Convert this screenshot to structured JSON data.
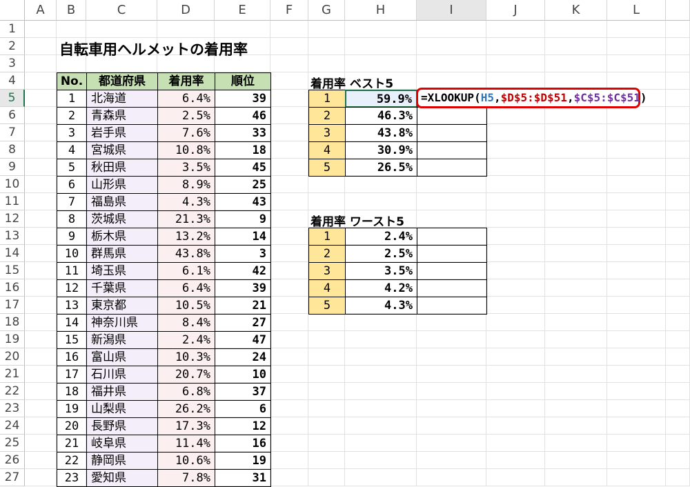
{
  "columns": [
    "A",
    "B",
    "C",
    "D",
    "E",
    "F",
    "G",
    "H",
    "I",
    "J",
    "K",
    "L",
    ""
  ],
  "rows": [
    "1",
    "2",
    "3",
    "4",
    "5",
    "6",
    "7",
    "8",
    "9",
    "10",
    "11",
    "12",
    "13",
    "14",
    "15",
    "16",
    "17",
    "18",
    "19",
    "20",
    "21",
    "22",
    "23",
    "24",
    "25",
    "26",
    "27"
  ],
  "title": "自転車用ヘルメットの着用率",
  "table": {
    "headers": [
      "No.",
      "都道府県",
      "着用率",
      "順位"
    ],
    "rows": [
      [
        "1",
        "北海道",
        "6.4%",
        "39"
      ],
      [
        "2",
        "青森県",
        "2.5%",
        "46"
      ],
      [
        "3",
        "岩手県",
        "7.6%",
        "33"
      ],
      [
        "4",
        "宮城県",
        "10.8%",
        "18"
      ],
      [
        "5",
        "秋田県",
        "3.5%",
        "45"
      ],
      [
        "6",
        "山形県",
        "8.9%",
        "25"
      ],
      [
        "7",
        "福島県",
        "4.3%",
        "43"
      ],
      [
        "8",
        "茨城県",
        "21.3%",
        "9"
      ],
      [
        "9",
        "栃木県",
        "13.2%",
        "14"
      ],
      [
        "10",
        "群馬県",
        "43.8%",
        "3"
      ],
      [
        "11",
        "埼玉県",
        "6.1%",
        "42"
      ],
      [
        "12",
        "千葉県",
        "6.4%",
        "39"
      ],
      [
        "13",
        "東京都",
        "10.5%",
        "21"
      ],
      [
        "14",
        "神奈川県",
        "8.4%",
        "27"
      ],
      [
        "15",
        "新潟県",
        "2.4%",
        "47"
      ],
      [
        "16",
        "富山県",
        "10.3%",
        "24"
      ],
      [
        "17",
        "石川県",
        "20.7%",
        "10"
      ],
      [
        "18",
        "福井県",
        "6.8%",
        "37"
      ],
      [
        "19",
        "山梨県",
        "26.2%",
        "6"
      ],
      [
        "20",
        "長野県",
        "17.3%",
        "12"
      ],
      [
        "21",
        "岐阜県",
        "11.4%",
        "16"
      ],
      [
        "22",
        "静岡県",
        "10.6%",
        "19"
      ],
      [
        "23",
        "愛知県",
        "7.8%",
        "31"
      ]
    ]
  },
  "best": {
    "label": "着用率 ベスト5",
    "rows": [
      [
        "1",
        "59.9%"
      ],
      [
        "2",
        "46.3%"
      ],
      [
        "3",
        "43.8%"
      ],
      [
        "4",
        "30.9%"
      ],
      [
        "5",
        "26.5%"
      ]
    ]
  },
  "worst": {
    "label": "着用率 ワースト5",
    "rows": [
      [
        "1",
        "2.4%"
      ],
      [
        "2",
        "2.5%"
      ],
      [
        "3",
        "3.5%"
      ],
      [
        "4",
        "4.2%"
      ],
      [
        "5",
        "4.3%"
      ]
    ]
  },
  "formula": {
    "prefix": "=XLOOKUP(",
    "arg1": "H5",
    "sep1": ",",
    "arg2": "$D$5:$D$51",
    "sep2": ",",
    "arg3": "$C$5:$C$51",
    "suffix": ")",
    "colors": {
      "arg1": "#2e75b6",
      "arg2": "#c00000",
      "arg3": "#7030a0"
    }
  }
}
